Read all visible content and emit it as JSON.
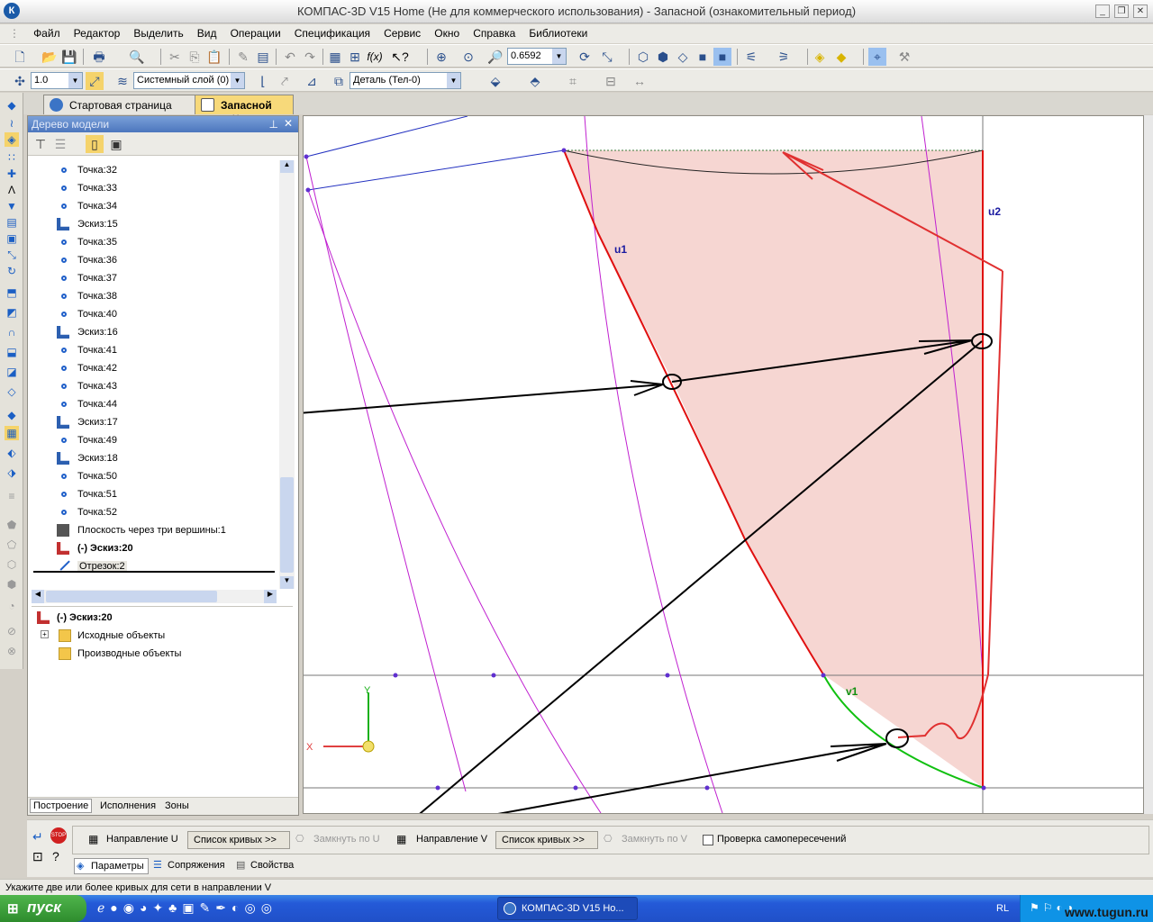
{
  "window": {
    "title": "КОМПАС-3D V15 Home (Не для коммерческого использования) - Запасной (ознакомительный период)"
  },
  "menu": [
    "Файл",
    "Редактор",
    "Выделить",
    "Вид",
    "Операции",
    "Спецификация",
    "Сервис",
    "Окно",
    "Справка",
    "Библиотеки"
  ],
  "toolbar": {
    "zoom_value": "0.6592",
    "step_value": "1.0",
    "layer_value": "Системный слой (0)",
    "detail_value": "Деталь (Тел-0)"
  },
  "tabs": [
    {
      "label": "Стартовая страница",
      "active": false
    },
    {
      "label": "Запасной",
      "active": true
    }
  ],
  "tree": {
    "title": "Дерево модели",
    "items": [
      {
        "label": "Точка:32",
        "kind": "point"
      },
      {
        "label": "Точка:33",
        "kind": "point"
      },
      {
        "label": "Точка:34",
        "kind": "point"
      },
      {
        "label": "Эскиз:15",
        "kind": "sketch"
      },
      {
        "label": "Точка:35",
        "kind": "point"
      },
      {
        "label": "Точка:36",
        "kind": "point"
      },
      {
        "label": "Точка:37",
        "kind": "point"
      },
      {
        "label": "Точка:38",
        "kind": "point"
      },
      {
        "label": "Точка:40",
        "kind": "point"
      },
      {
        "label": "Эскиз:16",
        "kind": "sketch"
      },
      {
        "label": "Точка:41",
        "kind": "point"
      },
      {
        "label": "Точка:42",
        "kind": "point"
      },
      {
        "label": "Точка:43",
        "kind": "point"
      },
      {
        "label": "Точка:44",
        "kind": "point"
      },
      {
        "label": "Эскиз:17",
        "kind": "sketch"
      },
      {
        "label": "Точка:49",
        "kind": "point"
      },
      {
        "label": "Эскиз:18",
        "kind": "sketch"
      },
      {
        "label": "Точка:50",
        "kind": "point"
      },
      {
        "label": "Точка:51",
        "kind": "point"
      },
      {
        "label": "Точка:52",
        "kind": "point"
      },
      {
        "label": "Плоскость через три вершины:1",
        "kind": "plane"
      },
      {
        "label": "(-) Эскиз:20",
        "kind": "sketch-red"
      },
      {
        "label": "Отрезок:2",
        "kind": "segment"
      }
    ],
    "lower": [
      {
        "label": "(-) Эскиз:20",
        "kind": "sketch-red"
      },
      {
        "label": "Исходные объекты",
        "kind": "folder"
      },
      {
        "label": "Производные объекты",
        "kind": "folder"
      }
    ],
    "bottom_tabs": [
      "Построение",
      "Исполнения",
      "Зоны"
    ]
  },
  "canvas_labels": {
    "u1": "u1",
    "u2": "u2",
    "v1": "v1",
    "x": "X",
    "y": "Y"
  },
  "properties": {
    "dir_u": "Направление U",
    "curves_u": "Список кривых",
    "close_u": "Замкнуть по U",
    "dir_v": "Направление V",
    "curves_v": "Список кривых",
    "close_v": "Замкнуть по V",
    "self_check": "Проверка самопересечений",
    "tab_params": "Параметры",
    "tab_mates": "Сопряжения",
    "tab_props": "Свойства"
  },
  "status": "Укажите две или более кривых для сети в направлении V",
  "taskbar": {
    "start": "пуск",
    "item": "КОМПАС-3D V15 Ho...",
    "lang": "RL",
    "watermark": "www.tugun.ru"
  }
}
